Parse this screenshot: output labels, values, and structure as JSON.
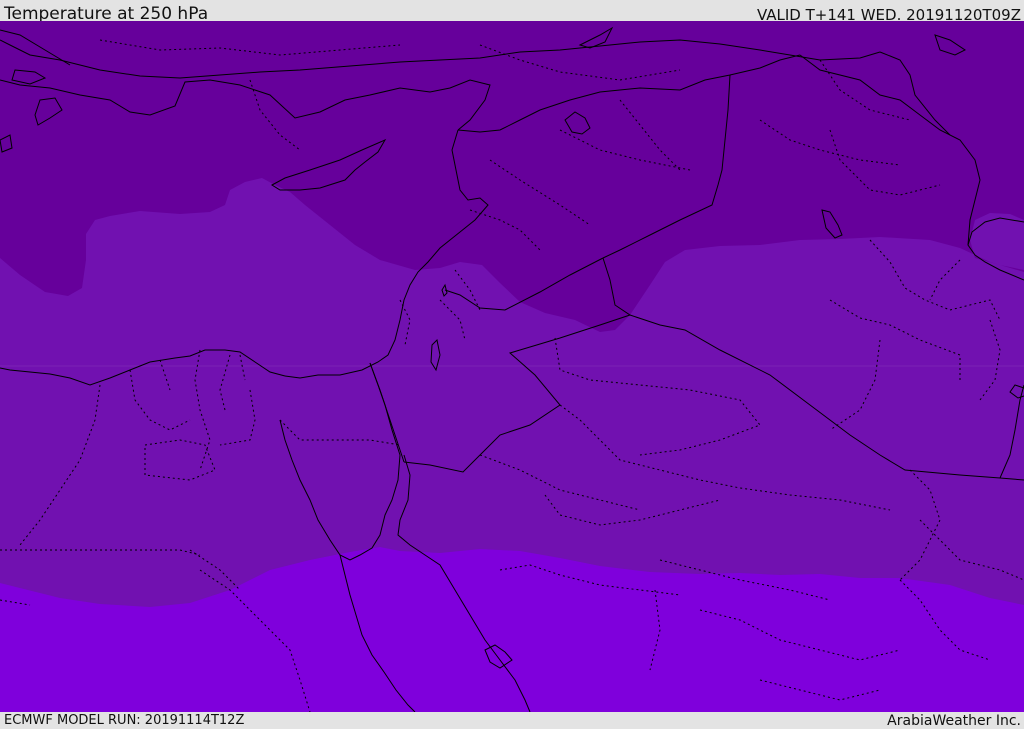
{
  "header": {
    "title": "Temperature at 250 hPa",
    "valid_time": "VALID T+141 WED. 20191120T09Z"
  },
  "footer": {
    "model_run": "ECMWF MODEL RUN: 20191114T12Z",
    "credit": "ArabiaWeather Inc."
  },
  "map": {
    "layers": [
      "temperature-bands",
      "coastlines",
      "country-borders",
      "province-borders"
    ],
    "bands": [
      {
        "id": "coldest",
        "color": "#66009b"
      },
      {
        "id": "cold",
        "color": "#7111b0"
      },
      {
        "id": "mild",
        "color": "#7f00dc"
      }
    ],
    "line_color": "#000000"
  }
}
